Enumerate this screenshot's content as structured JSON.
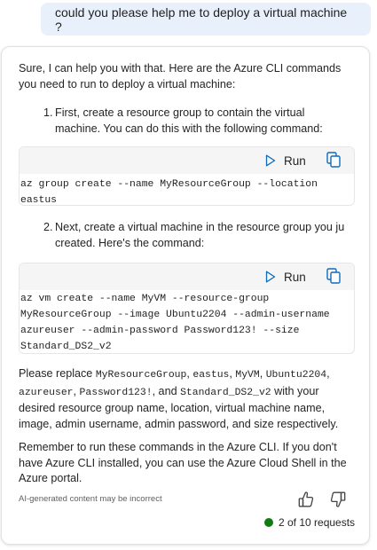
{
  "user_message": "could you please help me to deploy a virtual machine ?",
  "response": {
    "intro_line1": "Sure, I can help you with that. Here are the Azure CLI commands",
    "intro_line2": "you need to run to deploy a virtual machine:",
    "step1": {
      "number": "1.",
      "line1": "First, create a resource group to contain the virtual",
      "line2": "machine. You can do this with the following command:"
    },
    "code1": {
      "run_label": "Run",
      "lines": [
        "az group create --name MyResourceGroup --location",
        "eastus"
      ]
    },
    "step2": {
      "number": "2.",
      "line1": "Next, create a virtual machine in the resource group you ju",
      "line2": "created. Here's the command:"
    },
    "code2": {
      "run_label": "Run",
      "lines": [
        "az vm create --name MyVM --resource-group",
        "MyResourceGroup --image Ubuntu2204 --admin-username",
        "azureuser --admin-password Password123! --size",
        "Standard_DS2_v2"
      ]
    },
    "replace_para": {
      "l1_a": "Please replace ",
      "t1": "MyResourceGroup",
      "l1_b": ", ",
      "t2": "eastus",
      "l1_c": ", ",
      "t3": "MyVM",
      "l1_d": ", ",
      "t4": "Ubuntu2204",
      "l1_e": ",",
      "t5": "azureuser",
      "l2_a": ", ",
      "t6": "Password123!",
      "l2_b": ", and ",
      "t7": "Standard_DS2_v2",
      "l2_c": " with your",
      "line3": "desired resource group name, location, virtual machine name,",
      "line4": "image, admin username, admin password, and size respectively."
    },
    "remember_para": {
      "line1": "Remember to run these commands in the Azure CLI. If you don't",
      "line2": "have Azure CLI installed, you can use the Azure Cloud Shell in the",
      "line3": "Azure portal."
    }
  },
  "footer": {
    "disclaimer": "AI-generated content may be incorrect",
    "requests": "2 of 10 requests",
    "status_color": "#107c10"
  },
  "icons": {
    "run": "play-icon",
    "copy": "copy-icon",
    "like": "thumbs-up-icon",
    "dislike": "thumbs-down-icon"
  }
}
